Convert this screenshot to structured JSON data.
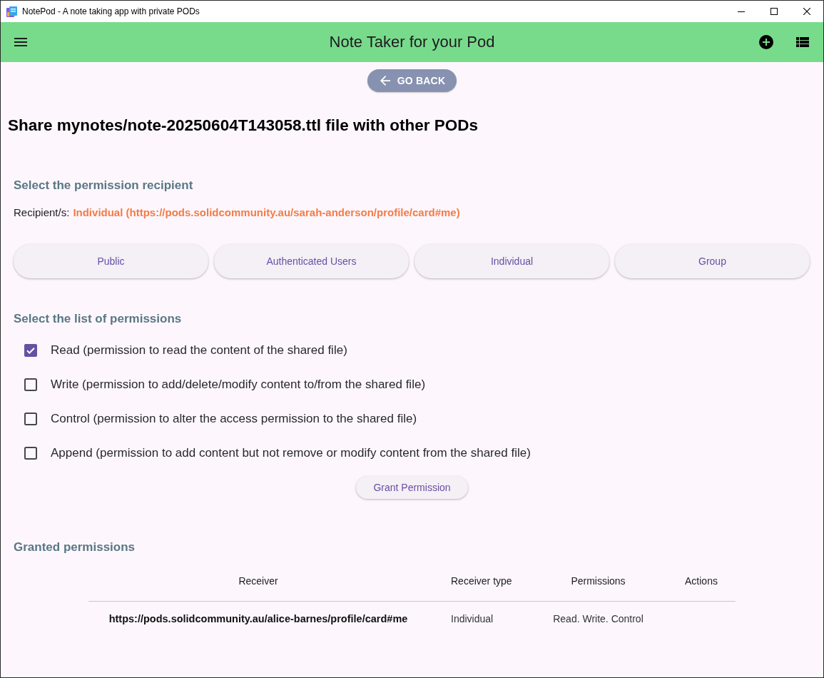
{
  "window": {
    "title": "NotePod - A note taking app with private PODs"
  },
  "app_bar": {
    "title": "Note Taker for your Pod"
  },
  "go_back": {
    "label": "GO BACK"
  },
  "heading": "Share mynotes/note-20250604T143058.ttl file with other PODs",
  "recipient_section": {
    "title": "Select the permission recipient",
    "label": "Recipient/s:",
    "value": "Individual (https://pods.solidcommunity.au/sarah-anderson/profile/card#me)",
    "options": [
      "Public",
      "Authenticated Users",
      "Individual",
      "Group"
    ]
  },
  "permissions_section": {
    "title": "Select the list of permissions",
    "permissions": [
      {
        "label": "Read (permission to read the content of the shared file)",
        "checked": true
      },
      {
        "label": "Write (permission to add/delete/modify content to/from the shared file)",
        "checked": false
      },
      {
        "label": "Control (permission to alter the access permission to the shared file)",
        "checked": false
      },
      {
        "label": "Append (permission to add content but not remove or modify content from the shared file)",
        "checked": false
      }
    ],
    "button": "Grant Permission"
  },
  "granted_section": {
    "title": "Granted permissions",
    "table": {
      "columns": [
        "Receiver",
        "Receiver type",
        "Permissions",
        "Actions"
      ],
      "rows": [
        {
          "receiver": "https://pods.solidcommunity.au/alice-barnes/profile/card#me",
          "receiver_type": "Individual",
          "permissions": "Read. Write. Control"
        }
      ]
    }
  }
}
